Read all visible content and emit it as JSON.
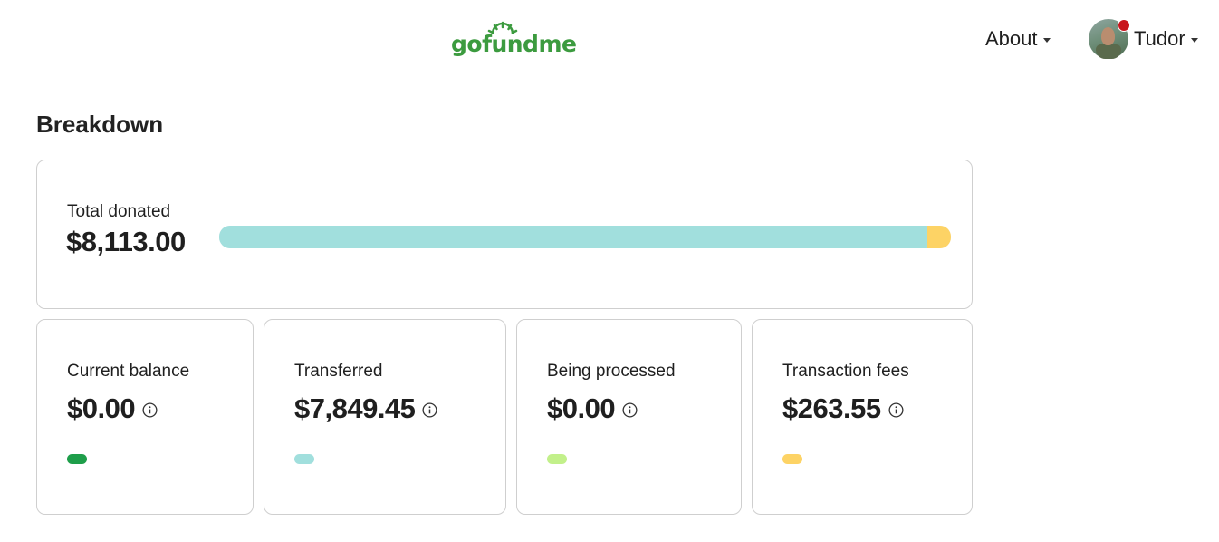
{
  "header": {
    "logo_text": "gofundme",
    "logo_color": "#3c9b3f",
    "about_label": "About",
    "user_name": "Tudor",
    "notification_color": "#c8161d"
  },
  "breakdown": {
    "title": "Breakdown",
    "total": {
      "label": "Total donated",
      "amount": "$8,113.00",
      "bar_segments": [
        {
          "name": "transferred",
          "value": 7849.45,
          "color": "#a1dfdd"
        },
        {
          "name": "transaction-fees",
          "value": 263.55,
          "color": "#fdd365"
        }
      ]
    },
    "stats": [
      {
        "label": "Current balance",
        "amount": "$0.00",
        "color": "#1e9e4a"
      },
      {
        "label": "Transferred",
        "amount": "$7,849.45",
        "color": "#a1dfdd"
      },
      {
        "label": "Being processed",
        "amount": "$0.00",
        "color": "#c2f08a"
      },
      {
        "label": "Transaction fees",
        "amount": "$263.55",
        "color": "#fdd365"
      }
    ]
  }
}
